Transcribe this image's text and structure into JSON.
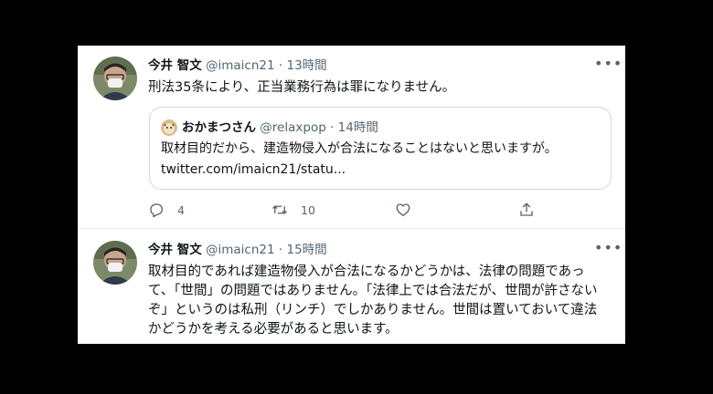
{
  "tweets": [
    {
      "name": "今井 智文",
      "handle": "@imaicn21",
      "dot": "·",
      "time": "13時間",
      "more": "•••",
      "text": "刑法35条により、正当業務行為は罪になりません。",
      "quote": {
        "name": "おかまつさん",
        "handle": "@relaxpop",
        "dot": "·",
        "time": "14時間",
        "text": "取材目的だから、建造物侵入が合法になることはないと思いますが。",
        "link": "twitter.com/imaicn21/statu..."
      },
      "actions": {
        "reply_icon": "reply-icon",
        "reply_count": "4",
        "retweet_icon": "retweet-icon",
        "retweet_count": "10",
        "like_icon": "heart-icon",
        "share_icon": "share-icon"
      }
    },
    {
      "name": "今井 智文",
      "handle": "@imaicn21",
      "dot": "·",
      "time": "15時間",
      "more": "•••",
      "text": "取材目的であれば建造物侵入が合法になるかどうかは、法律の問題であって、「世間」の問題ではありません。「法律上では合法だが、世間が許さないぞ」というのは私刑（リンチ）でしかありません。世間は置いておいて違法かどうかを考える必要があると思います。"
    }
  ],
  "colors": {
    "text": "#0f1419",
    "secondary": "#536471",
    "border": "#cfd9de",
    "background": "#ffffff",
    "frame": "#000000"
  }
}
